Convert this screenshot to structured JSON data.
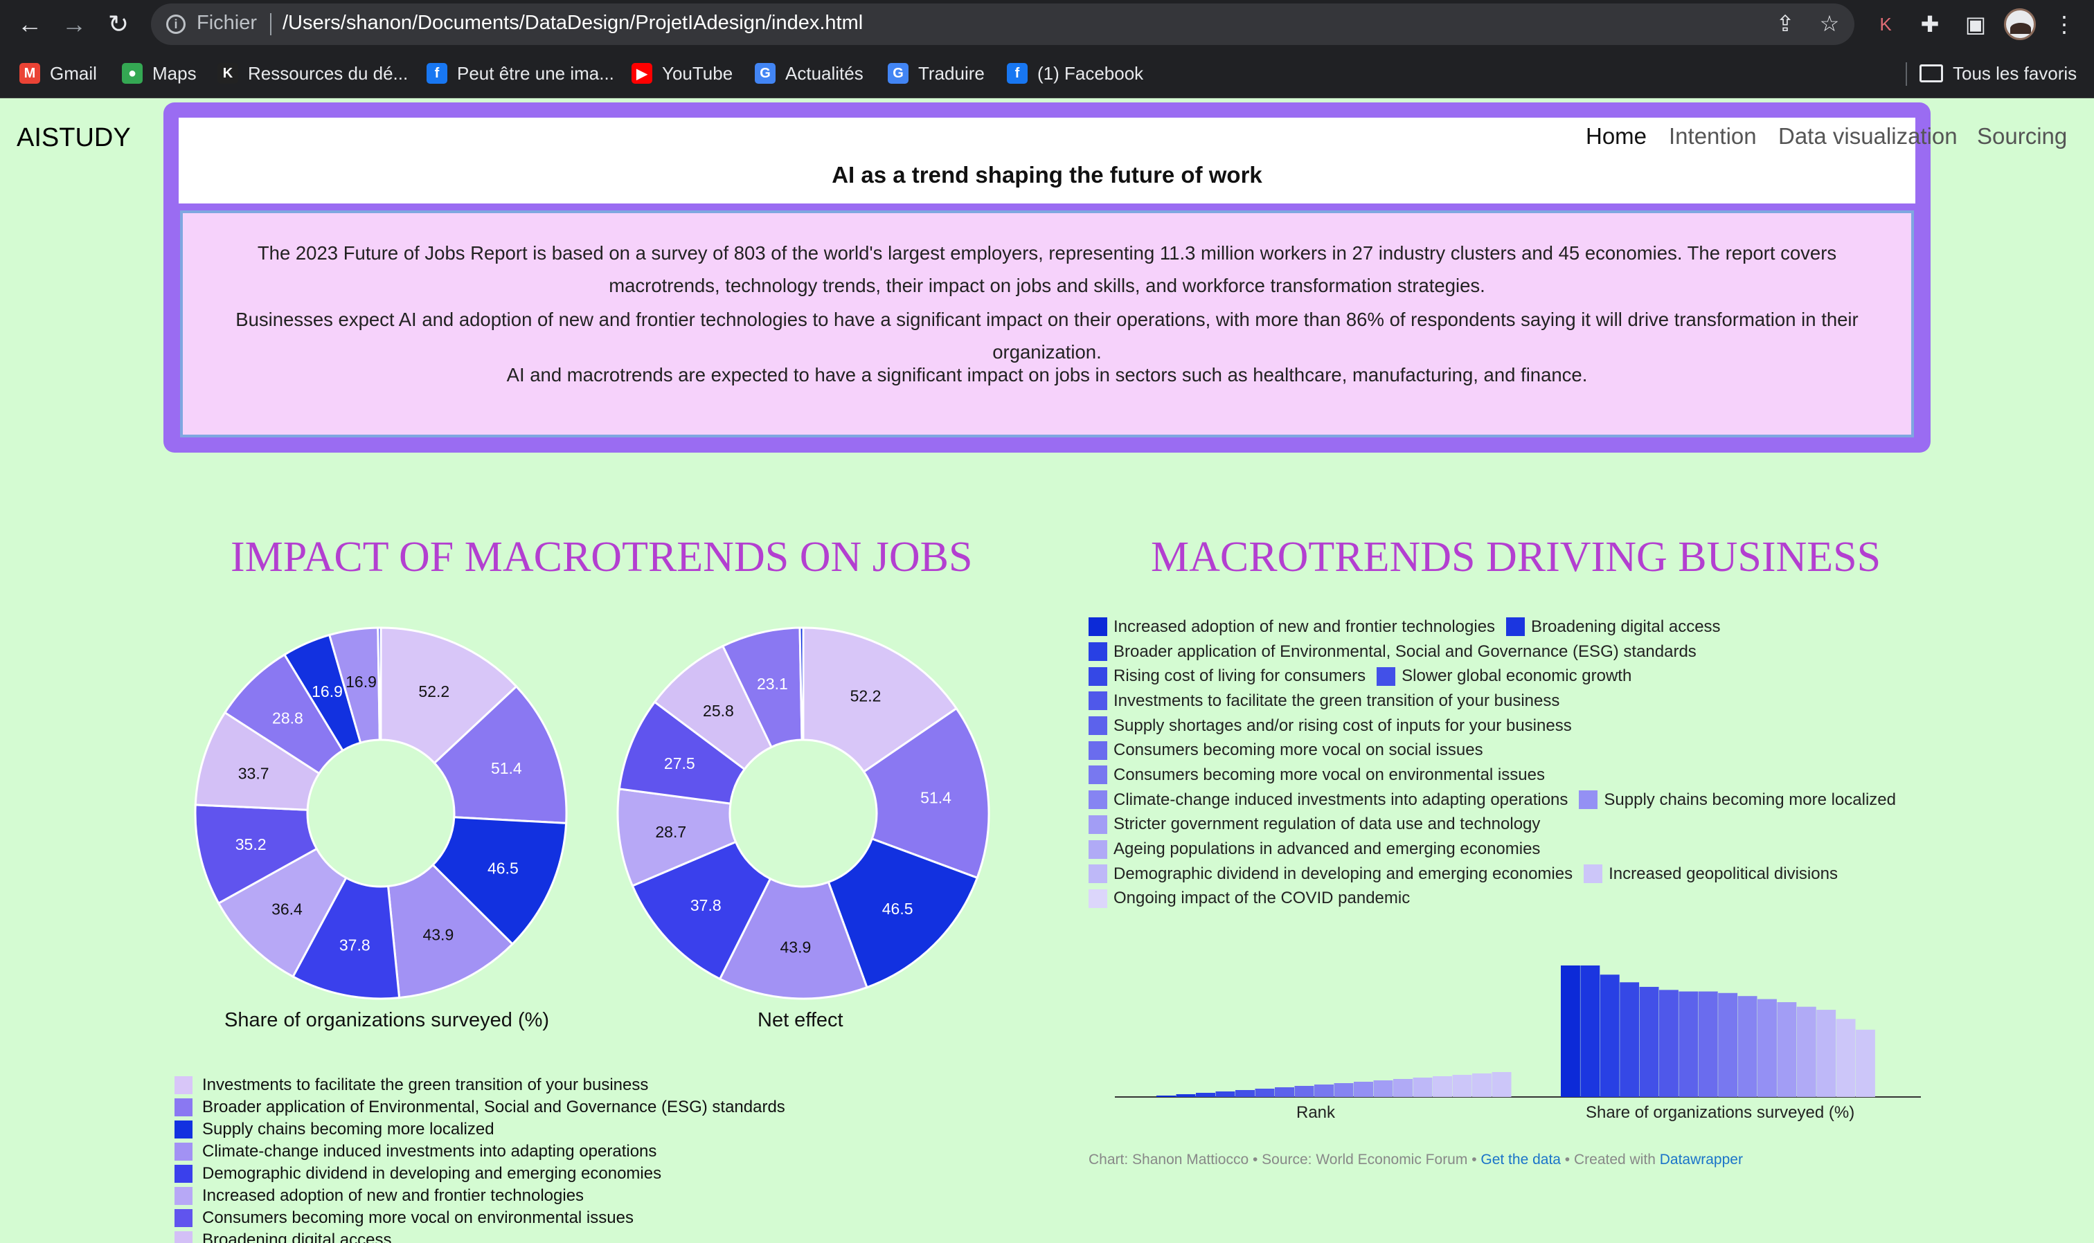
{
  "browser": {
    "scheme": "Fichier",
    "url": "/Users/shanon/Documents/DataDesign/ProjetIAdesign/index.html",
    "bookmarks": [
      {
        "label": "Gmail",
        "icon": "M",
        "color": "#ea4335"
      },
      {
        "label": "Maps",
        "icon": "●",
        "color": "#34a853"
      },
      {
        "label": "Ressources du dé...",
        "icon": "K",
        "color": "#222222"
      },
      {
        "label": "Peut être une ima...",
        "icon": "f",
        "color": "#1877f2"
      },
      {
        "label": "YouTube",
        "icon": "▶",
        "color": "#ff0000"
      },
      {
        "label": "Actualités",
        "icon": "G",
        "color": "#4285f4"
      },
      {
        "label": "Traduire",
        "icon": "G",
        "color": "#4285f4"
      },
      {
        "label": "(1) Facebook",
        "icon": "f",
        "color": "#1877f2"
      }
    ],
    "all_bookmarks": "Tous les favoris",
    "ext_k": "K"
  },
  "site": {
    "brand": "AISTUDY",
    "nav": [
      "Home",
      "Intention",
      "Data visualization",
      "Sourcing"
    ]
  },
  "hero": {
    "title": "AI as a trend shaping the future of work",
    "p1": "The 2023 Future of Jobs Report is based on a survey of 803 of the world's largest employers, representing 11.3 million workers in 27 industry clusters and 45 economies. The report covers macrotrends, technology trends, their impact on jobs and skills, and workforce transformation strategies.",
    "p2": "Businesses expect AI and adoption of new and frontier technologies to have a significant impact on their operations, with more than 86% of respondents saying it will drive transformation in their organization.",
    "p3": "AI and macrotrends are expected to have a significant impact on jobs in sectors such as healthcare, manufacturing, and finance."
  },
  "sections": {
    "left_title": "IMPACT OF MACROTRENDS ON JOBS",
    "right_title": "MACROTRENDS DRIVING BUSINESS"
  },
  "chart_data": [
    {
      "type": "pie",
      "title": "Share of organizations surveyed (%)",
      "donut": true,
      "values": [
        52.2,
        51.4,
        46.5,
        43.9,
        37.8,
        36.4,
        35.2,
        33.7,
        28.8,
        16.9,
        16.9,
        1.0
      ],
      "labels": [
        "52.2",
        "51.4",
        "46.5",
        "43.9",
        "37.8",
        "36.4",
        "35.2",
        "33.7",
        "28.8",
        "16.9",
        "16.9",
        ""
      ],
      "colors": [
        "#d8c6f8",
        "#8a78f2",
        "#1231e0",
        "#a292f4",
        "#3a40ec",
        "#b7a8f6",
        "#6054ee",
        "#d3c0f6",
        "#8a78f2",
        "#1231e0",
        "#a292f4",
        "#3a40ec"
      ]
    },
    {
      "type": "pie",
      "title": "Net effect",
      "donut": true,
      "values": [
        52.2,
        51.4,
        46.5,
        43.9,
        37.8,
        28.7,
        27.5,
        25.8,
        23.1,
        1.0
      ],
      "labels": [
        "52.2",
        "51.4",
        "46.5",
        "43.9",
        "37.8",
        "28.7",
        "27.5",
        "25.8",
        "23.1",
        ""
      ],
      "colors": [
        "#d8c6f8",
        "#8a78f2",
        "#1231e0",
        "#a292f4",
        "#3a40ec",
        "#b7a8f6",
        "#6054ee",
        "#d3c0f6",
        "#8a78f2",
        "#1231e0"
      ]
    },
    {
      "type": "bar",
      "categories": [
        "Rank",
        "Share of organizations surveyed (%)"
      ],
      "series_colors": [
        "#0c2ad8",
        "#1b36e0",
        "#2840e4",
        "#3548e6",
        "#4250e8",
        "#4f58ea",
        "#5c62ec",
        "#6a6cee",
        "#7878f0",
        "#8684f2",
        "#9490f4",
        "#a29df5",
        "#b0aaf6",
        "#beb8f8",
        "#ccc6f9"
      ],
      "rank": [
        1,
        2,
        3,
        4,
        5,
        6,
        7,
        8,
        9,
        10,
        11,
        12,
        13,
        14,
        15,
        16,
        17,
        18
      ],
      "share": [
        86,
        86,
        80,
        75,
        72,
        70,
        69,
        69,
        68,
        66,
        64,
        62,
        59,
        57,
        51,
        44
      ]
    }
  ],
  "left_legend": [
    {
      "label": "Investments to facilitate the green transition of your business",
      "color": "#d8c6f8"
    },
    {
      "label": "Broader application of Environmental, Social and Governance (ESG) standards",
      "color": "#8a78f2"
    },
    {
      "label": "Supply chains becoming more localized",
      "color": "#1231e0"
    },
    {
      "label": "Climate-change induced investments into adapting operations",
      "color": "#a292f4"
    },
    {
      "label": "Demographic dividend in developing and emerging economies",
      "color": "#3a40ec"
    },
    {
      "label": "Increased adoption of new and frontier technologies",
      "color": "#b7a8f6"
    },
    {
      "label": "Consumers becoming more vocal on environmental issues",
      "color": "#6054ee"
    },
    {
      "label": "Broadening digital access",
      "color": "#d3c0f6"
    }
  ],
  "right_legend_rows": [
    [
      {
        "label": "Increased adoption of new and frontier technologies",
        "color": "#0c2ad8"
      },
      {
        "label": "Broadening digital access",
        "color": "#1b36e0"
      }
    ],
    [
      {
        "label": "Broader application of Environmental, Social and Governance (ESG) standards",
        "color": "#2840e4"
      }
    ],
    [
      {
        "label": "Rising cost of living for consumers",
        "color": "#3548e6"
      },
      {
        "label": "Slower global economic growth",
        "color": "#4250e8"
      }
    ],
    [
      {
        "label": "Investments to facilitate the green transition of your business",
        "color": "#4f58ea"
      }
    ],
    [
      {
        "label": "Supply shortages and/or rising cost of inputs for your business",
        "color": "#5c62ec"
      }
    ],
    [
      {
        "label": "Consumers becoming more vocal on social issues",
        "color": "#6a6cee"
      }
    ],
    [
      {
        "label": "Consumers becoming more vocal on environmental issues",
        "color": "#7878f0"
      }
    ],
    [
      {
        "label": "Climate-change induced investments into adapting operations",
        "color": "#8684f2"
      },
      {
        "label": "Supply chains becoming more localized",
        "color": "#9490f4"
      }
    ],
    [
      {
        "label": "Stricter government regulation of data use and technology",
        "color": "#a29df5"
      }
    ],
    [
      {
        "label": "Ageing populations in advanced and emerging economies",
        "color": "#b0aaf6"
      }
    ],
    [
      {
        "label": "Demographic dividend in developing and emerging economies",
        "color": "#beb8f8"
      },
      {
        "label": "Increased geopolitical divisions",
        "color": "#ccc6f9"
      }
    ],
    [
      {
        "label": "Ongoing impact of the COVID pandemic",
        "color": "#dcd6fb"
      }
    ]
  ],
  "footer": {
    "prefix": "Chart: Shanon Mattiocco • Source: World Economic Forum • ",
    "get_data": "Get the data",
    "mid": " • Created with ",
    "created_with": "Datawrapper"
  }
}
